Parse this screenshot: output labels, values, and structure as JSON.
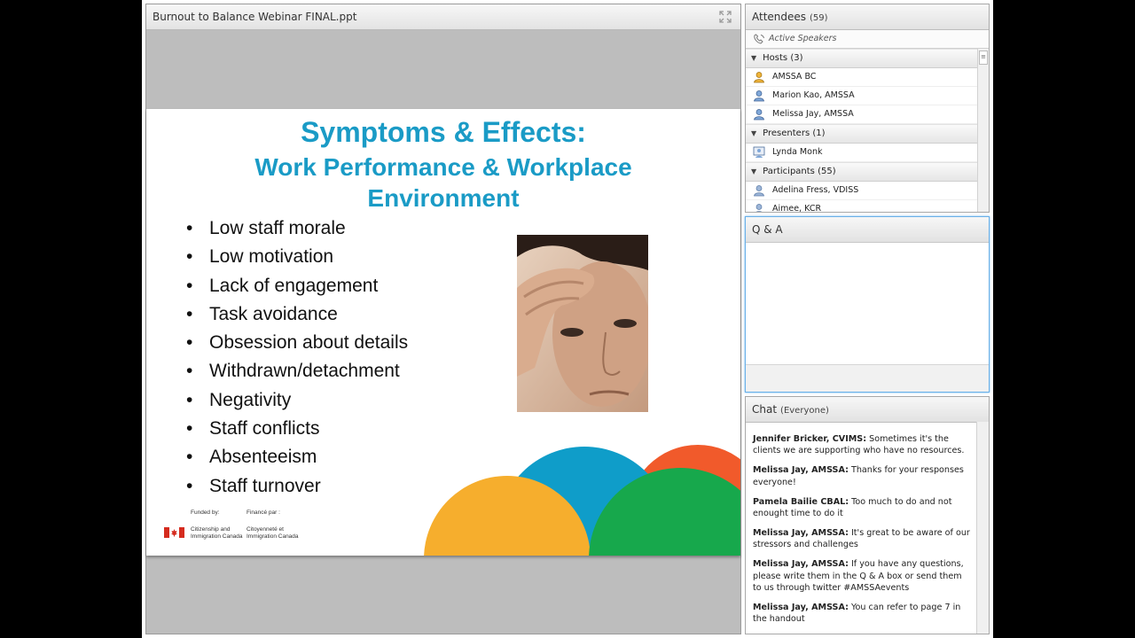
{
  "share": {
    "title": "Burnout to Balance Webinar FINAL.ppt",
    "expand_icon": "expand-arrows-icon"
  },
  "slide": {
    "title_line1": "Symptoms & Effects:",
    "title_line2": "Work Performance & Workplace",
    "title_line3": "Environment",
    "bullets": [
      "Low staff morale",
      "Low motivation",
      "Lack of engagement",
      "Task avoidance",
      "Obsession about details",
      "Withdrawn/detachment",
      "Negativity",
      "Staff conflicts",
      "Absenteeism",
      "Staff turnover"
    ],
    "funded_by_en": "Funded by:",
    "funded_by_fr": "Financé par :",
    "dept_en": "Citizenship and Immigration Canada",
    "dept_fr": "Citoyenneté et Immigration Canada",
    "circle_colors": [
      "#f15a2b",
      "#0f9dc9",
      "#f6ae2d",
      "#17a84c"
    ],
    "photo_caption": "photo of a stressed man holding his forehead"
  },
  "attendees": {
    "title": "Attendees",
    "count": "(59)",
    "active_speakers": "Active Speakers",
    "hosts": {
      "label": "Hosts (3)",
      "people": [
        "AMSSA BC",
        "Marion Kao, AMSSA",
        "Melissa Jay, AMSSA"
      ]
    },
    "presenters": {
      "label": "Presenters (1)",
      "people": [
        "Lynda Monk"
      ]
    },
    "participants": {
      "label": "Participants (55)",
      "people": [
        "Adelina Fress, VDISS",
        "Aimee, KCR"
      ]
    }
  },
  "qa": {
    "title": "Q & A"
  },
  "chat": {
    "title": "Chat",
    "scope": "(Everyone)",
    "messages": [
      {
        "sender": "Jennifer Bricker, CVIMS:",
        "text": "Sometimes it's the clients we are supporting who have no resources."
      },
      {
        "sender": "Melissa Jay, AMSSA:",
        "text": "Thanks for your responses everyone!"
      },
      {
        "sender": "Pamela Bailie CBAL:",
        "text": "Too much to do and not enought time to do it"
      },
      {
        "sender": "Melissa Jay, AMSSA:",
        "text": "It's great to be aware of our stressors and challenges"
      },
      {
        "sender": "Melissa Jay, AMSSA:",
        "text": "If you have any questions, please write them in the Q & A box or send them to us through twitter #AMSSAevents"
      },
      {
        "sender": "Melissa Jay, AMSSA:",
        "text": "You can refer to page 7 in the handout"
      }
    ]
  }
}
